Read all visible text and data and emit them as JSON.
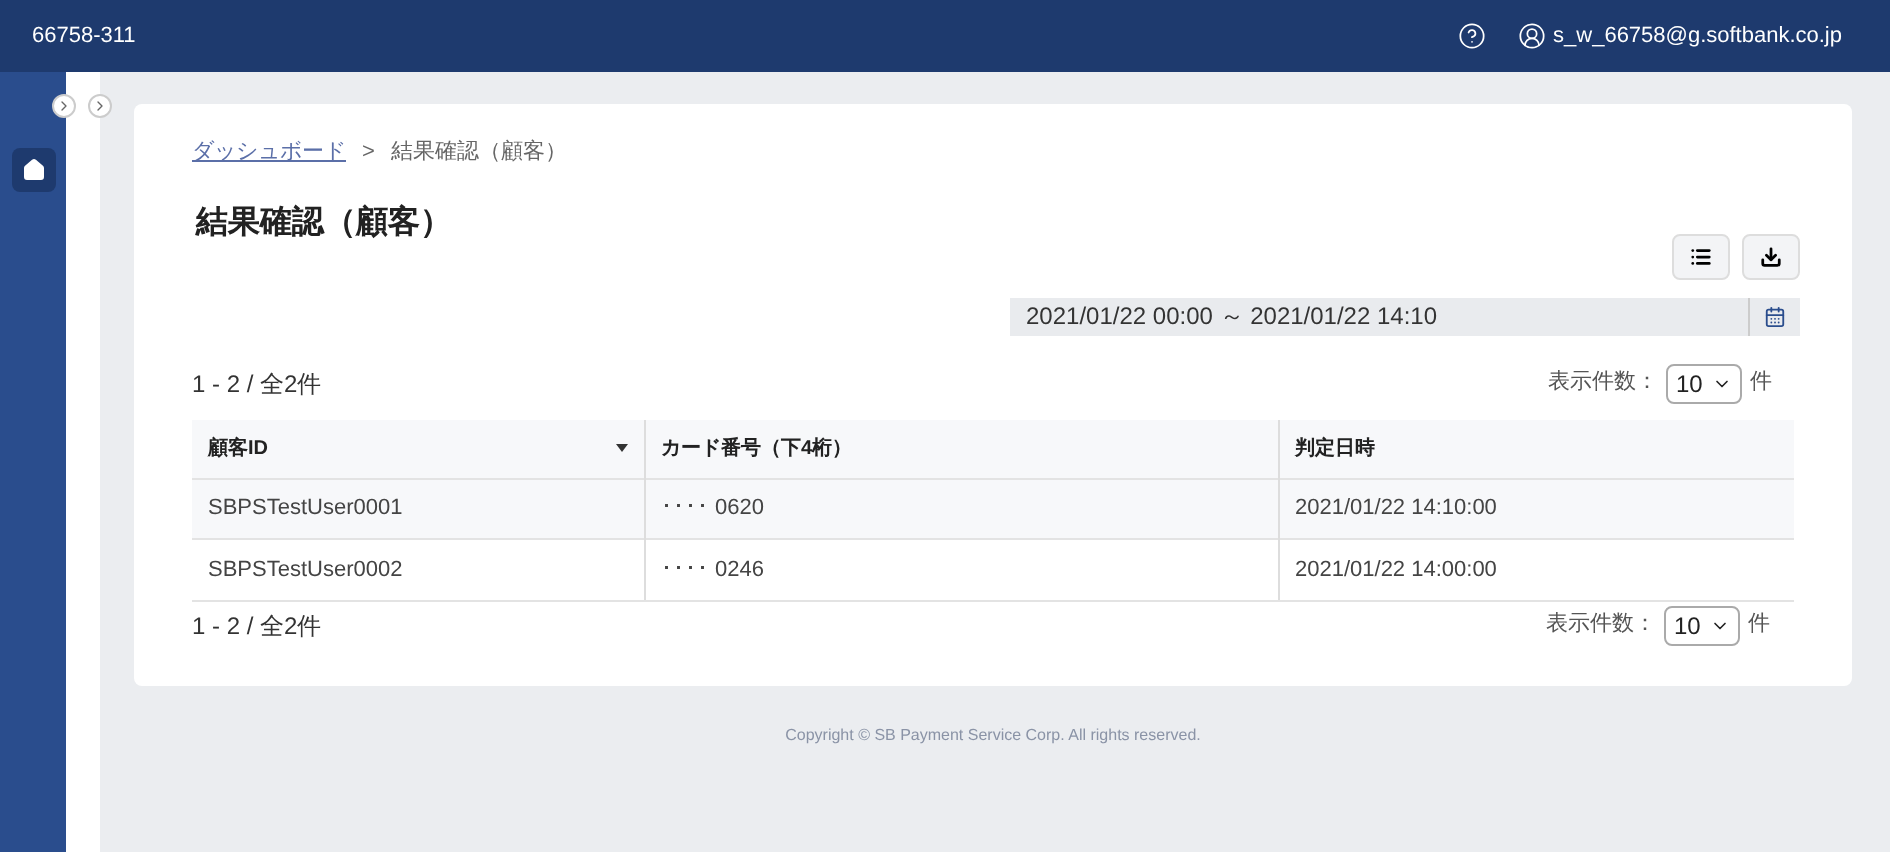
{
  "header": {
    "account_code": "66758-311",
    "user_email": "s_w_66758@g.softbank.co.jp"
  },
  "breadcrumb": [
    {
      "label": "ダッシュボード",
      "kind": "link"
    },
    {
      "label": "結果確認（顧客）",
      "kind": "current"
    }
  ],
  "breadcrumb_separator": ">",
  "page_title": "結果確認（顧客）",
  "date_range": {
    "value": "2021/01/22 00:00 ～ 2021/01/22 14:10"
  },
  "top_pager": {
    "summary": "1 - 2 / 全2件",
    "per_page_label": "表示件数：",
    "per_page": "10",
    "unit": "件"
  },
  "table": {
    "columns": [
      {
        "label": "顧客ID",
        "sortable": true
      },
      {
        "label": "カード番号（下4桁）",
        "sortable": false
      },
      {
        "label": "判定日時",
        "sortable": false
      }
    ],
    "rows": [
      [
        "SBPSTestUser0001",
        "････ 0620",
        "2021/01/22 14:10:00"
      ],
      [
        "SBPSTestUser0002",
        "････ 0246",
        "2021/01/22 14:00:00"
      ]
    ]
  },
  "bottom_pager": {
    "summary": "1 - 2 / 全2件",
    "per_page_label": "表示件数：",
    "per_page": "10",
    "unit": "件"
  },
  "footer": "Copyright © SB Payment Service Corp. All rights reserved."
}
